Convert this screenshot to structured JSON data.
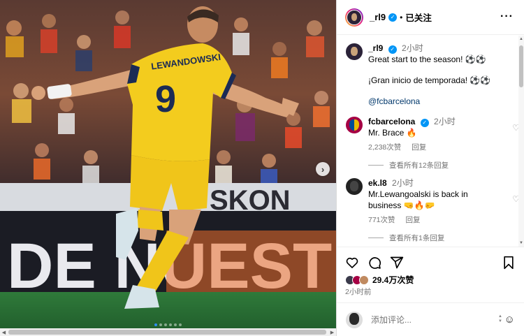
{
  "post": {
    "username": "_rl9",
    "separator": "•",
    "follow_label": "已关注",
    "more_label": "···"
  },
  "comments": [
    {
      "username": "_rl9",
      "time": "2小时",
      "lines": [
        "Great start to the season! ⚽⚽",
        "¡Gran inicio de temporada! ⚽⚽",
        "@fcbarcelona"
      ]
    },
    {
      "username": "fcbarcelona",
      "time": "2小时",
      "text": "Mr. Brace 🔥",
      "likes": "2,238次赞",
      "reply_label": "回复",
      "view_replies": "查看所有12条回复"
    },
    {
      "username": "ek.l8",
      "time": "2小时",
      "text": "Mr.Lewangoalski is back in business 🤜🔥🤛",
      "likes": "771次赞",
      "reply_label": "回复",
      "view_replies": "查看所有1条回复"
    }
  ],
  "stats": {
    "likes": "29.4万次赞",
    "posted": "2小时前"
  },
  "composer": {
    "placeholder": "添加评论..."
  },
  "media": {
    "jersey_name": "LEWANDOWSKI",
    "jersey_number": "9",
    "banner_text": "DE NUEST",
    "sponsor_text": "SKON",
    "next_icon": "›",
    "slides": 6,
    "active_slide": 1
  },
  "colors": {
    "kit_yellow": "#f3cc1e",
    "kit_accent": "#1b2b55",
    "banner_orange": "#ec6d2a",
    "link": "#00376b",
    "verified": "#0095f6"
  },
  "icons": [
    "heart-icon",
    "comment-icon",
    "share-icon",
    "bookmark-icon",
    "verified-icon",
    "emoji-icon",
    "more-icon",
    "chevron-right-icon"
  ]
}
